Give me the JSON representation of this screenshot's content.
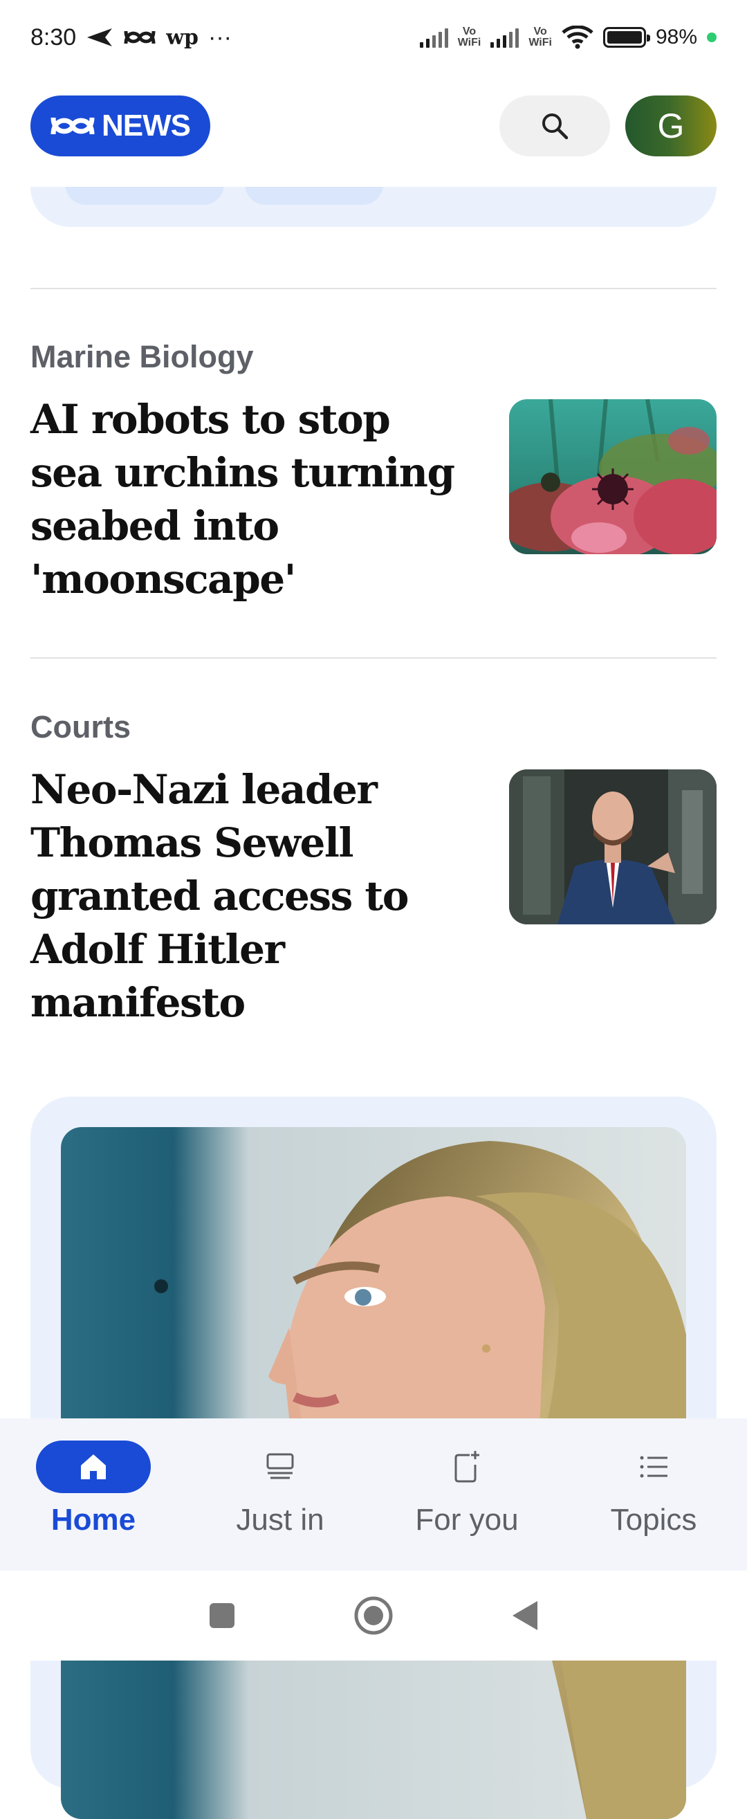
{
  "status_bar": {
    "time": "8:30",
    "carrier_text": "wp",
    "more": "···",
    "vowifi_1": "Vo\nWiFi",
    "vowifi_2": "Vo\nWiFi",
    "battery": "98%"
  },
  "header": {
    "logo_text": "NEWS",
    "logo_mark": "ꟿ",
    "avatar_initial": "G"
  },
  "articles": [
    {
      "category": "Marine Biology",
      "headline": "AI robots to stop sea urchins turning seabed into 'moonscape'"
    },
    {
      "category": "Courts",
      "headline": "Neo-Nazi leader Thomas Sewell granted access to Adolf Hitler manifesto"
    }
  ],
  "bottom_nav": {
    "items": [
      {
        "label": "Home",
        "icon": "home-icon",
        "active": true
      },
      {
        "label": "Just in",
        "icon": "just-in-icon",
        "active": false
      },
      {
        "label": "For you",
        "icon": "for-you-icon",
        "active": false
      },
      {
        "label": "Topics",
        "icon": "topics-icon",
        "active": false
      }
    ]
  },
  "colors": {
    "brand": "#1a4bd6",
    "card_bg": "#eaf1fd",
    "nav_bg": "#f3f5fb"
  }
}
